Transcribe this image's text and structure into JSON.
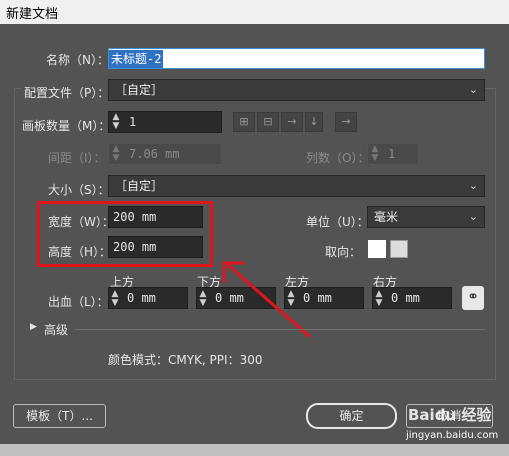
{
  "window": {
    "title": "新建文档"
  },
  "form": {
    "name_label": "名称（N）：",
    "name_value": "未标题-2",
    "profile_label": "配置文件（P）：",
    "profile_value": "［自定］",
    "artboards_label": "画板数量（M）：",
    "artboards_value": "1",
    "spacing_label": "间距（I）：",
    "spacing_value": "7.06 mm",
    "columns_label": "列数（O）：",
    "columns_value": "1",
    "size_label": "大小（S）：",
    "size_value": "［自定］",
    "width_label": "宽度（W）：",
    "width_value": "200 mm",
    "height_label": "高度（H）：",
    "height_value": "200 mm",
    "units_label": "单位（U）：",
    "units_value": "毫米",
    "orientation_label": "取向：",
    "bleed_label": "出血（L）：",
    "bleed": [
      {
        "label": "上方",
        "value": "0 mm"
      },
      {
        "label": "下方",
        "value": "0 mm"
      },
      {
        "label": "左方",
        "value": "0 mm"
      },
      {
        "label": "右方",
        "value": "0 mm"
      }
    ],
    "advanced_label": "高级",
    "color_mode_text": "颜色模式：CMYK, PPI：300"
  },
  "buttons": {
    "templates": "模板（T）...",
    "ok": "确定",
    "cancel": "取消"
  },
  "watermark": {
    "brand": "Baidu 经验",
    "url": "jingyan.baidu.com"
  },
  "colors": {
    "highlight": "#e0141e",
    "selection": "#2f72c4"
  }
}
